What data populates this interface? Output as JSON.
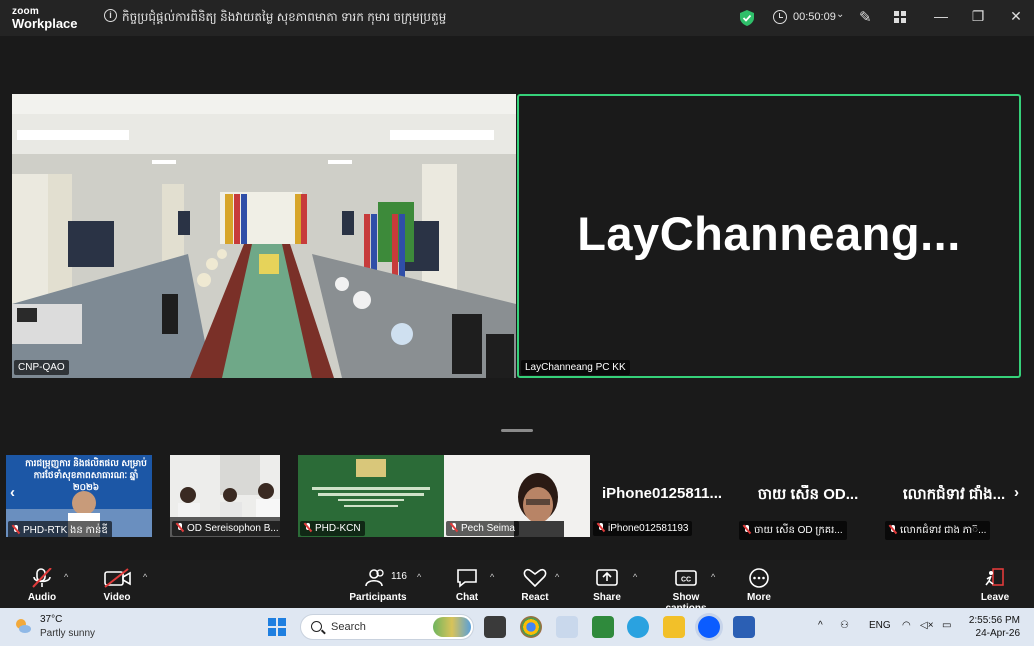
{
  "titlebar": {
    "logo_line1": "zoom",
    "logo_line2": "Workplace",
    "meeting_title": "កិច្ចប្រជុំផ្ដល់ការពិនិត្យ និងវាយតម្លៃ សុខភាពមាតា ទារក កុមារ ចក្រុមប្រតួម្ជ",
    "timer": "00:50:09"
  },
  "main": {
    "left_tile_label": "CNP-QAO",
    "right_tile_name": "LayChanneang...",
    "right_tile_label": "LayChanneang PC KK"
  },
  "strip": {
    "tiles": [
      {
        "label": "PHD-RTK ងន កាន់ឌី",
        "slide_text": "ការជម្រុញការ និងផលិតផល សម្រាប់ការថែទាំសុខភាពសាធារណៈ ឆ្នាំ ២០២៦"
      },
      {
        "label": "OD Sereisophon B..."
      },
      {
        "label": "PHD-KCN"
      },
      {
        "label": "Pech Seima"
      },
      {
        "name": "iPhone0125811...",
        "label": "iPhone012581193"
      },
      {
        "name": "ចាយ សើន OD...",
        "label": "ចាយ សើន OD ក្រគរ..."
      },
      {
        "name": "លោកជំទាវ ជាំង...",
        "label": "លោកជំទាវ ជាង ភា៊..."
      }
    ]
  },
  "toolbar": {
    "audio": "Audio",
    "video": "Video",
    "participants": "Participants",
    "participants_count": "116",
    "chat": "Chat",
    "react": "React",
    "share": "Share",
    "captions": "Show captions",
    "more": "More",
    "leave": "Leave"
  },
  "taskbar": {
    "temperature": "37°C",
    "condition": "Partly sunny",
    "search_placeholder": "Search",
    "language": "ENG",
    "time": "2:55:56 PM",
    "date": "24-Apr-26"
  }
}
